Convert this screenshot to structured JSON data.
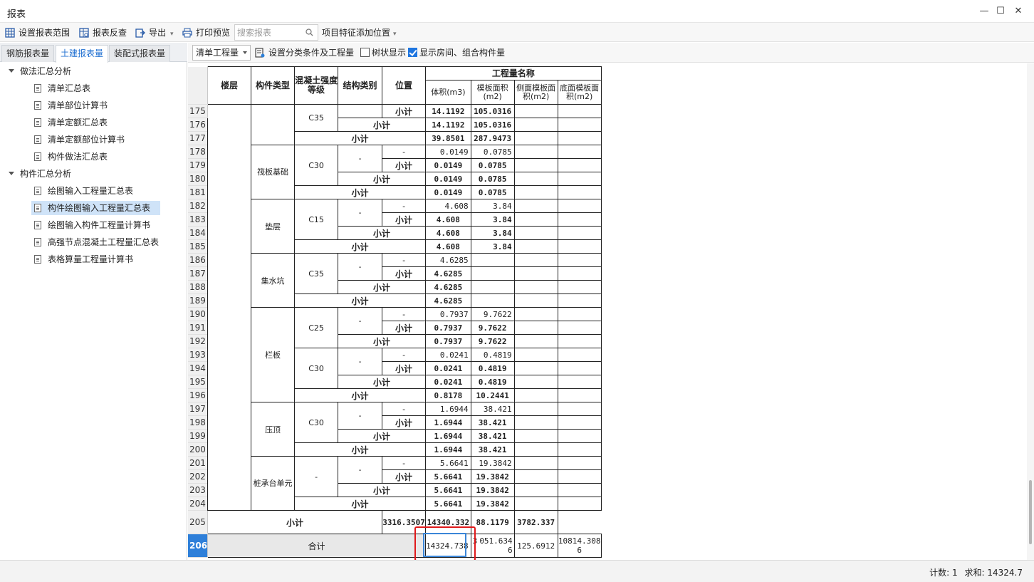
{
  "window": {
    "title": "报表",
    "minimize": "—",
    "maximize": "☐",
    "close": "✕"
  },
  "toolbar": {
    "set_range": "设置报表范围",
    "reverse_check": "报表反查",
    "export": "导出",
    "print_preview": "打印预览",
    "search_placeholder": "搜索报表",
    "add_position": "项目特征添加位置"
  },
  "tabs": [
    "钢筋报表量",
    "土建报表量",
    "装配式报表量"
  ],
  "tree": {
    "group1": "做法汇总分析",
    "group1_items": [
      "清单汇总表",
      "清单部位计算书",
      "清单定额汇总表",
      "清单定额部位计算书",
      "构件做法汇总表"
    ],
    "group2": "构件汇总分析",
    "group2_items": [
      "绘图输入工程量汇总表",
      "构件绘图输入工程量汇总表",
      "绘图输入构件工程量计算书",
      "高强节点混凝土工程量汇总表",
      "表格算量工程量计算书"
    ]
  },
  "right_toolbar": {
    "dropdown": "清单工程量",
    "set_conditions": "设置分类条件及工程量",
    "tree_display": "树状显示",
    "show_rooms": "显示房间、组合构件量"
  },
  "table": {
    "headers": {
      "floor": "楼层",
      "component_type": "构件类型",
      "concrete_grade": "混凝土强度等级",
      "structure_type": "结构类别",
      "position": "位置",
      "quantity_name": "工程量名称",
      "volume": "体积(m3)",
      "formwork_area": "模板面积(m2)",
      "side_formwork": "侧面模板面积(m2)",
      "bottom_formwork": "底面模板面积(m2)"
    },
    "subtotal": "小计",
    "dash": "-",
    "rows": {
      "r175": {
        "n": "175",
        "grade": "C35",
        "v": "14.1192",
        "f": "105.0316"
      },
      "r176": {
        "n": "176",
        "v": "14.1192",
        "f": "105.0316"
      },
      "r177": {
        "n": "177",
        "v": "39.8501",
        "f": "287.9473"
      },
      "r178": {
        "n": "178",
        "type": "筏板基础",
        "grade": "C30",
        "v": "0.0149",
        "f": "0.0785"
      },
      "r179": {
        "n": "179",
        "v": "0.0149",
        "f": "0.0785"
      },
      "r180": {
        "n": "180",
        "v": "0.0149",
        "f": "0.0785"
      },
      "r181": {
        "n": "181",
        "v": "0.0149",
        "f": "0.0785"
      },
      "r182": {
        "n": "182",
        "type": "垫层",
        "grade": "C15",
        "v": "4.608",
        "f": "3.84"
      },
      "r183": {
        "n": "183",
        "v": "4.608",
        "f": "3.84"
      },
      "r184": {
        "n": "184",
        "v": "4.608",
        "f": "3.84"
      },
      "r185": {
        "n": "185",
        "v": "4.608",
        "f": "3.84"
      },
      "r186": {
        "n": "186",
        "type": "集水坑",
        "grade": "C35",
        "v": "4.6285"
      },
      "r187": {
        "n": "187",
        "v": "4.6285"
      },
      "r188": {
        "n": "188",
        "v": "4.6285"
      },
      "r189": {
        "n": "189",
        "v": "4.6285"
      },
      "r190": {
        "n": "190",
        "type": "栏板",
        "grade": "C25",
        "v": "0.7937",
        "f": "9.7622"
      },
      "r191": {
        "n": "191",
        "v": "0.7937",
        "f": "9.7622"
      },
      "r192": {
        "n": "192",
        "v": "0.7937",
        "f": "9.7622"
      },
      "r193": {
        "n": "193",
        "grade": "C30",
        "v": "0.0241",
        "f": "0.4819"
      },
      "r194": {
        "n": "194",
        "v": "0.0241",
        "f": "0.4819"
      },
      "r195": {
        "n": "195",
        "v": "0.0241",
        "f": "0.4819"
      },
      "r196": {
        "n": "196",
        "v": "0.8178",
        "f": "10.2441"
      },
      "r197": {
        "n": "197",
        "type": "压顶",
        "grade": "C30",
        "v": "1.6944",
        "f": "38.421"
      },
      "r198": {
        "n": "198",
        "v": "1.6944",
        "f": "38.421"
      },
      "r199": {
        "n": "199",
        "v": "1.6944",
        "f": "38.421"
      },
      "r200": {
        "n": "200",
        "v": "1.6944",
        "f": "38.421"
      },
      "r201": {
        "n": "201",
        "type": "桩承台单元",
        "grade": "-",
        "v": "5.6641",
        "f": "19.3842"
      },
      "r202": {
        "n": "202",
        "v": "5.6641",
        "f": "19.3842"
      },
      "r203": {
        "n": "203",
        "v": "5.6641",
        "f": "19.3842"
      },
      "r204": {
        "n": "204",
        "v": "5.6641",
        "f": "19.3842"
      },
      "r205": {
        "n": "205",
        "v": "3316.3507",
        "f": "14340.332",
        "s": "88.1179",
        "b": "3782.337"
      },
      "r206": {
        "n": "206",
        "label": "合计",
        "v": "14324.738",
        "f_prefix": "3",
        "f": "051.6346",
        "s": "125.6912",
        "b": "10814.3086"
      }
    }
  },
  "status": {
    "count_label": "计数:",
    "count": "1",
    "sum_label": "求和:",
    "sum": "14324.7"
  },
  "colors": {
    "accent": "#1f76e0",
    "highlight": "#e0191b",
    "selected_row": "#2e7fd9"
  }
}
